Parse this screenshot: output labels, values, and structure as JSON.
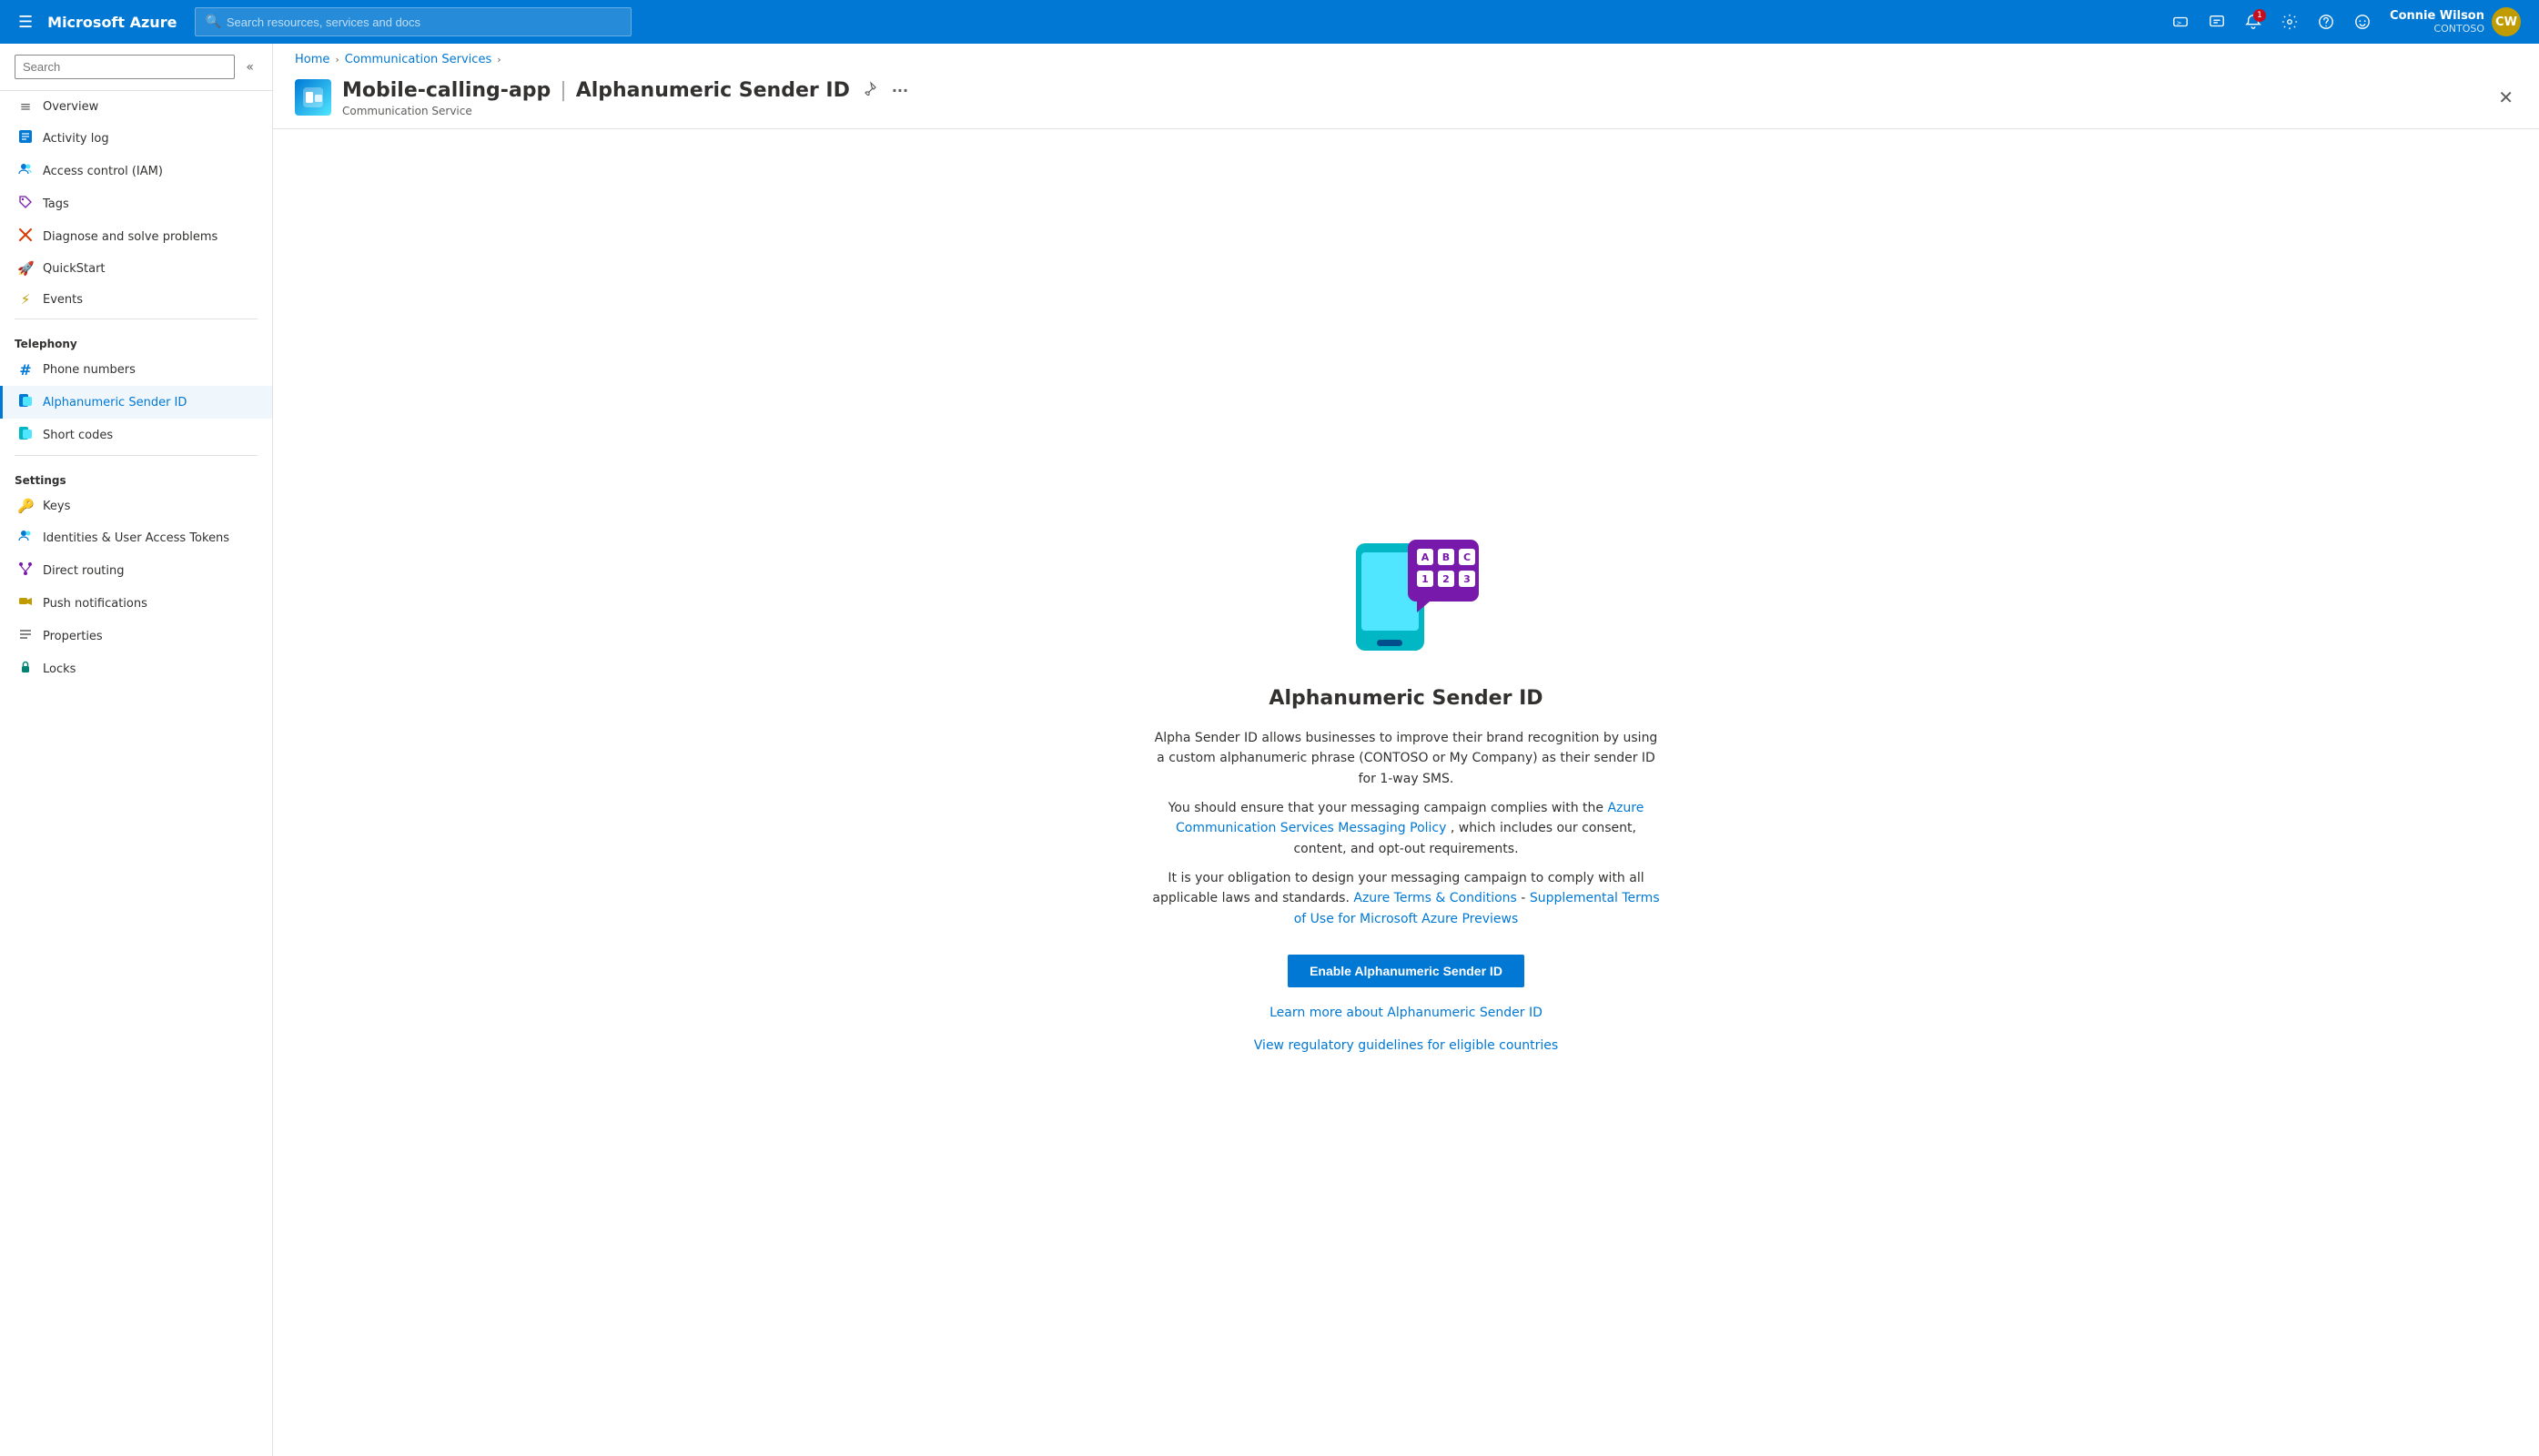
{
  "topnav": {
    "brand": "Microsoft Azure",
    "search_placeholder": "Search resources, services and docs",
    "user": {
      "name": "Connie Wilson",
      "org": "CONTOSO"
    }
  },
  "breadcrumb": {
    "home": "Home",
    "service": "Communication Services"
  },
  "page": {
    "resource_title": "Mobile-calling-app",
    "separator": "|",
    "page_name": "Alphanumeric Sender ID",
    "subtitle": "Communication Service"
  },
  "sidebar": {
    "search_placeholder": "Search",
    "items_general": [
      {
        "label": "Overview",
        "icon": "≡",
        "id": "overview"
      },
      {
        "label": "Activity log",
        "icon": "📋",
        "id": "activity-log"
      },
      {
        "label": "Access control (IAM)",
        "icon": "👥",
        "id": "iam"
      },
      {
        "label": "Tags",
        "icon": "🏷",
        "id": "tags"
      },
      {
        "label": "Diagnose and solve problems",
        "icon": "✖",
        "id": "diagnose"
      },
      {
        "label": "QuickStart",
        "icon": "🚀",
        "id": "quickstart"
      },
      {
        "label": "Events",
        "icon": "⚡",
        "id": "events"
      }
    ],
    "section_telephony": "Telephony",
    "items_telephony": [
      {
        "label": "Phone numbers",
        "icon": "#",
        "id": "phone-numbers"
      },
      {
        "label": "Alphanumeric Sender ID",
        "icon": "📟",
        "id": "alphanumeric-sender-id",
        "active": true
      },
      {
        "label": "Short codes",
        "icon": "📟",
        "id": "short-codes"
      }
    ],
    "section_settings": "Settings",
    "items_settings": [
      {
        "label": "Keys",
        "icon": "🔑",
        "id": "keys"
      },
      {
        "label": "Identities & User Access Tokens",
        "icon": "👥",
        "id": "identities"
      },
      {
        "label": "Direct routing",
        "icon": "📞",
        "id": "direct-routing"
      },
      {
        "label": "Push notifications",
        "icon": "💬",
        "id": "push-notifications"
      },
      {
        "label": "Properties",
        "icon": "⚙",
        "id": "properties"
      },
      {
        "label": "Locks",
        "icon": "🔒",
        "id": "locks"
      }
    ]
  },
  "content": {
    "illustration_letters_row1": [
      "A",
      "B",
      "C"
    ],
    "illustration_letters_row2": [
      "1",
      "2",
      "3"
    ],
    "feature_title": "Alphanumeric Sender ID",
    "description_part1": "Alpha Sender ID allows businesses to improve their brand recognition by using a custom alphanumeric phrase (CONTOSO or My Company) as their sender ID for 1-way SMS.",
    "description_part2": "You should ensure that your messaging campaign complies with the",
    "link_messaging_policy": "Azure Communication Services Messaging Policy",
    "description_part3": ", which includes our consent, content, and opt-out requirements.",
    "description_part4": "It is your obligation to design your messaging campaign to comply with all applicable laws and standards.",
    "link_terms": "Azure Terms & Conditions",
    "link_supplemental": "Supplemental Terms of Use for Microsoft Azure Previews",
    "enable_btn": "Enable Alphanumeric Sender ID",
    "learn_more_link": "Learn more about Alphanumeric Sender ID",
    "regulatory_link": "View regulatory guidelines for eligible countries"
  }
}
